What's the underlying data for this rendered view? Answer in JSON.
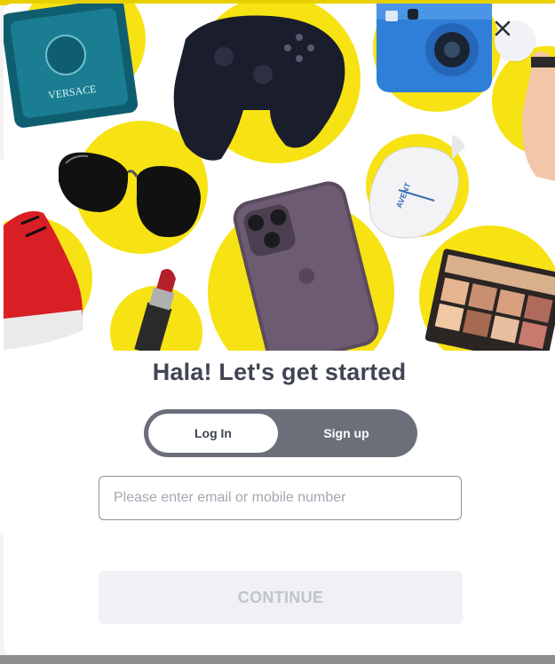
{
  "modal": {
    "title": "Hala! Let's get started",
    "close_icon": "close-icon",
    "toggle": {
      "login_label": "Log In",
      "signup_label": "Sign up",
      "selected": "Log In"
    },
    "email_input": {
      "placeholder": "Please enter email or mobile number",
      "value": ""
    },
    "continue_label": "CONTINUE"
  },
  "hero": {
    "accent_color": "#f7e214",
    "items": [
      "perfume-bottle",
      "game-controller",
      "instant-camera",
      "sunglasses",
      "smartphone",
      "baby-bottle",
      "sneaker",
      "lipstick",
      "eyeshadow-palette",
      "pouch"
    ],
    "perfume_brand": "VERSACE",
    "bottle_brand": "AVENT"
  },
  "colors": {
    "title": "#404553",
    "toggle_bg": "#6b6f7a",
    "button_disabled_bg": "#f0f1f4",
    "button_disabled_text": "#c1c4cc"
  }
}
